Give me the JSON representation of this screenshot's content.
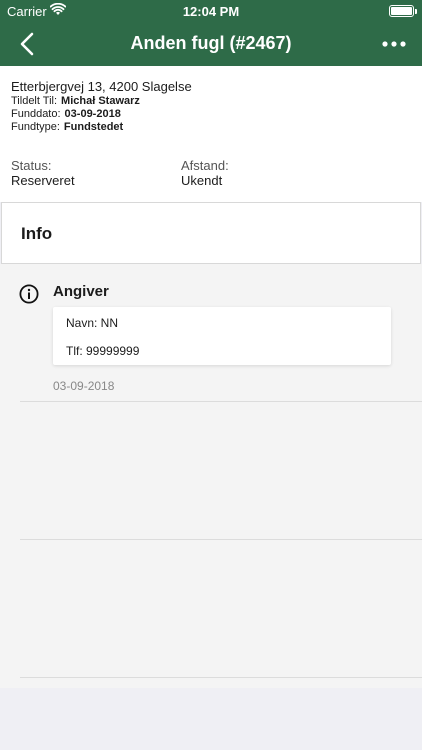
{
  "status_bar": {
    "carrier": "Carrier",
    "time": "12:04 PM",
    "battery_level": 1.0
  },
  "navbar": {
    "title": "Anden fugl (#2467)",
    "icons": [
      "chevron-left-icon",
      "more-icon"
    ]
  },
  "header": {
    "address": "Etterbjergvej 13, 4200 Slagelse",
    "assigned_label": "Tildelt Til:",
    "assigned_value": "Michał Stawarz",
    "found_date_label": "Funddato:",
    "found_date_value": "03-09-2018",
    "found_type_label": "Fundtype:",
    "found_type_value": "Fundstedet",
    "status_label": "Status:",
    "status_value": "Reserveret",
    "distance_label": "Afstand:",
    "distance_value": "Ukendt"
  },
  "tab": {
    "title": "Info"
  },
  "section": {
    "title": "Angiver",
    "icon": "info-icon",
    "name_line": "Navn: NN",
    "phone_line": "Tlf: 99999999",
    "date": "03-09-2018"
  },
  "colors": {
    "brand": "#2e6b48",
    "background": "#efeff4"
  }
}
